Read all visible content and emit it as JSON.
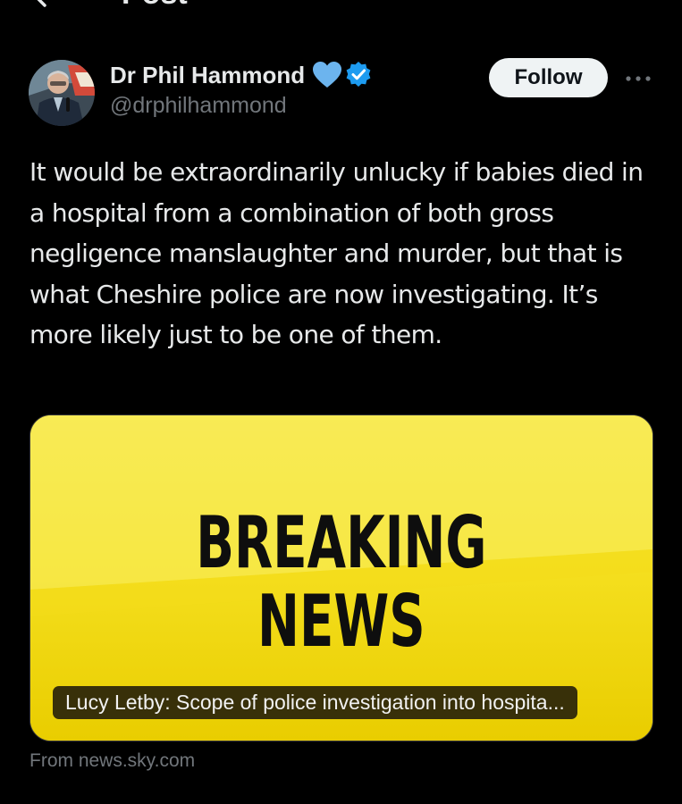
{
  "header": {
    "title": "Post",
    "back_icon": "arrow-left-icon"
  },
  "author": {
    "name": "Dr Phil Hammond",
    "handle": "@drphilhammond",
    "avatar_icon": "avatar",
    "badges": [
      "blue-heart-icon",
      "verified-badge-icon"
    ]
  },
  "follow": {
    "label": "Follow"
  },
  "more_icon": "more-options-icon",
  "tweet": {
    "text": "It would be extraordinarily unlucky if babies died in a hospital from a combination of both gross negligence manslaughter and murder, but that is what Cheshire police are now investigating. It’s more likely just to be one of them."
  },
  "link_card": {
    "image_text": [
      "BREAKING",
      "NEWS"
    ],
    "title": "Lucy Letby: Scope of police investigation into hospita...",
    "source": "From news.sky.com"
  },
  "colors": {
    "background": "#000000",
    "text_primary": "#e7e9ea",
    "text_secondary": "#71767b",
    "follow_bg": "#eff3f4",
    "verified_blue": "#1d9bf0",
    "heart_blue": "#6cb4ee",
    "breaking_yellow": "#f3d800"
  }
}
